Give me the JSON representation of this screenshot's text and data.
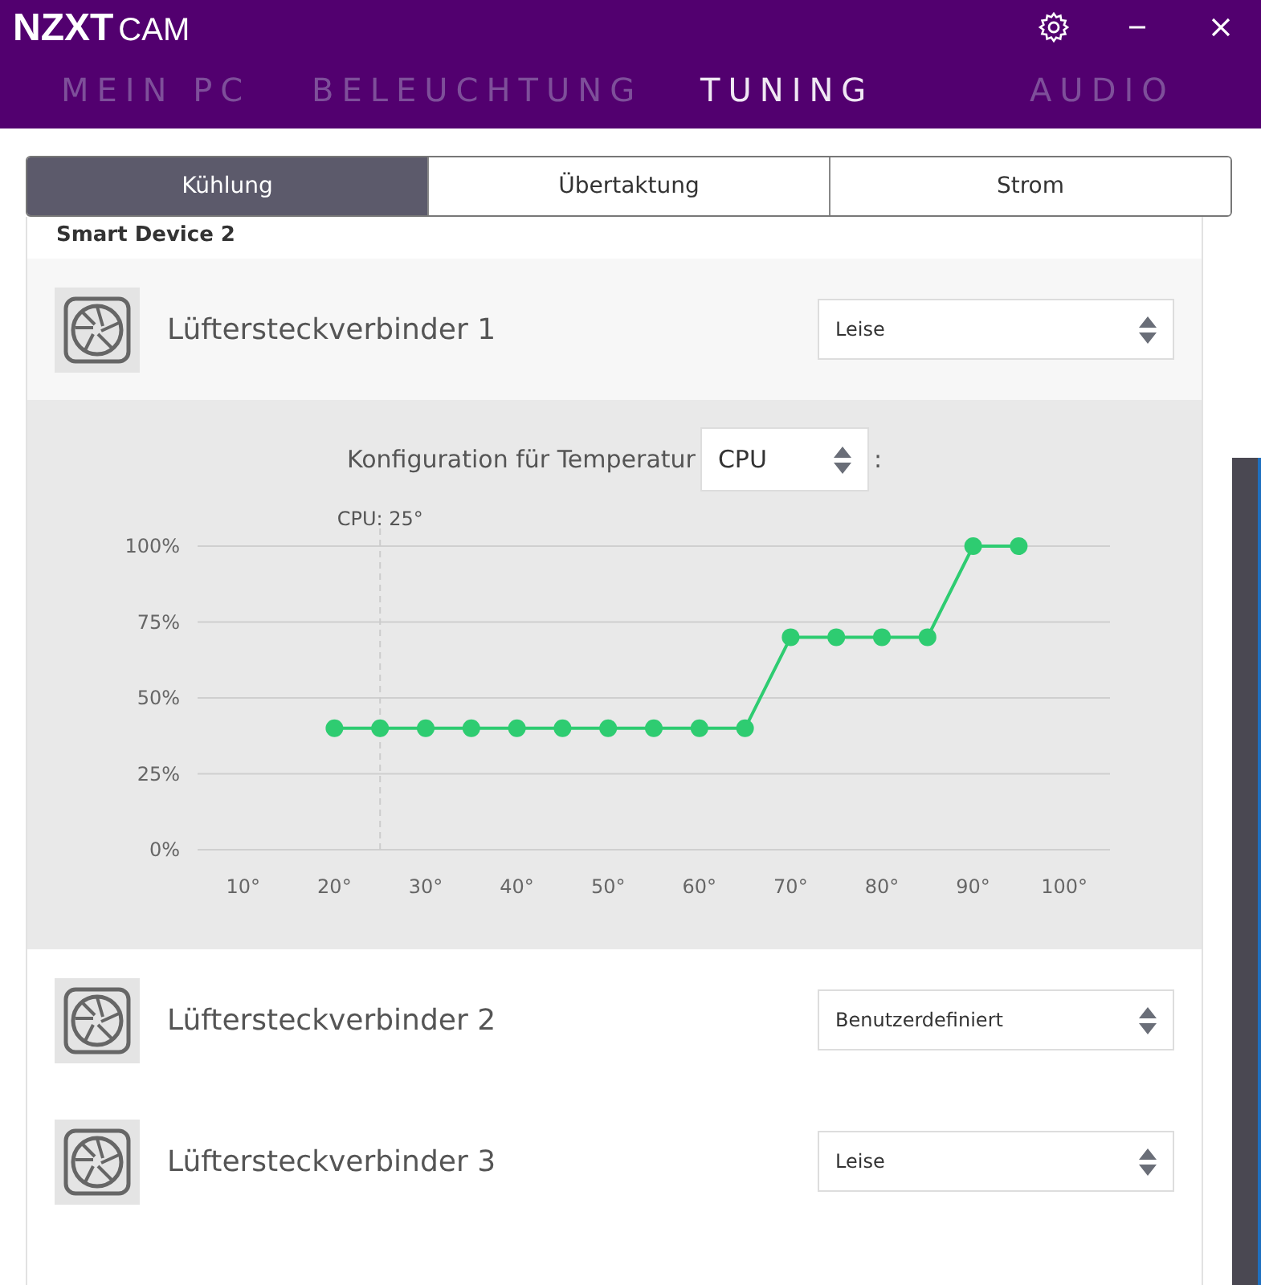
{
  "app": {
    "logo_main": "NZXT",
    "logo_sub": "CAM"
  },
  "nav": [
    {
      "label": "MEIN PC",
      "selected": false
    },
    {
      "label": "BELEUCHTUNG",
      "selected": false
    },
    {
      "label": "TUNING",
      "selected": true
    },
    {
      "label": "AUDIO",
      "selected": false
    }
  ],
  "tabs": [
    {
      "label": "Kühlung",
      "selected": true
    },
    {
      "label": "Übertaktung",
      "selected": false
    },
    {
      "label": "Strom",
      "selected": false
    }
  ],
  "device": {
    "name": "Smart Device 2"
  },
  "fans": [
    {
      "name": "Lüftersteckverbinder 1",
      "mode": "Leise",
      "curve": {
        "config": {
          "label": "Konfiguration für Temperatur",
          "source": "CPU",
          "suffix": ":"
        },
        "chart_data": {
          "type": "line",
          "x": [
            20,
            25,
            30,
            35,
            40,
            45,
            50,
            55,
            60,
            65,
            70,
            75,
            80,
            85,
            90,
            95
          ],
          "series": [
            {
              "color": "#2ecc71",
              "marker": "circle",
              "values": [
                40,
                40,
                40,
                40,
                40,
                40,
                40,
                40,
                40,
                40,
                70,
                70,
                70,
                70,
                100,
                100
              ]
            }
          ],
          "xlim": [
            5,
            105
          ],
          "ylim": [
            0,
            100
          ],
          "grid": true,
          "xticks": [
            {
              "value": 10,
              "label": "10°"
            },
            {
              "value": 20,
              "label": "20°"
            },
            {
              "value": 30,
              "label": "30°"
            },
            {
              "value": 40,
              "label": "40°"
            },
            {
              "value": 50,
              "label": "50°"
            },
            {
              "value": 60,
              "label": "60°"
            },
            {
              "value": 70,
              "label": "70°"
            },
            {
              "value": 80,
              "label": "80°"
            },
            {
              "value": 90,
              "label": "90°"
            },
            {
              "value": 100,
              "label": "100°"
            }
          ],
          "yticks": [
            {
              "value": 0,
              "label": "0%"
            },
            {
              "value": 25,
              "label": "25%"
            },
            {
              "value": 50,
              "label": "50%"
            },
            {
              "value": 75,
              "label": "75%"
            },
            {
              "value": 100,
              "label": "100%"
            }
          ],
          "ref_lines": [
            {
              "axis": "x",
              "value": 25,
              "label": "CPU: 25°"
            }
          ]
        }
      }
    },
    {
      "name": "Lüftersteckverbinder 2",
      "mode": "Benutzerdefiniert"
    },
    {
      "name": "Lüftersteckverbinder 3",
      "mode": "Leise"
    }
  ]
}
